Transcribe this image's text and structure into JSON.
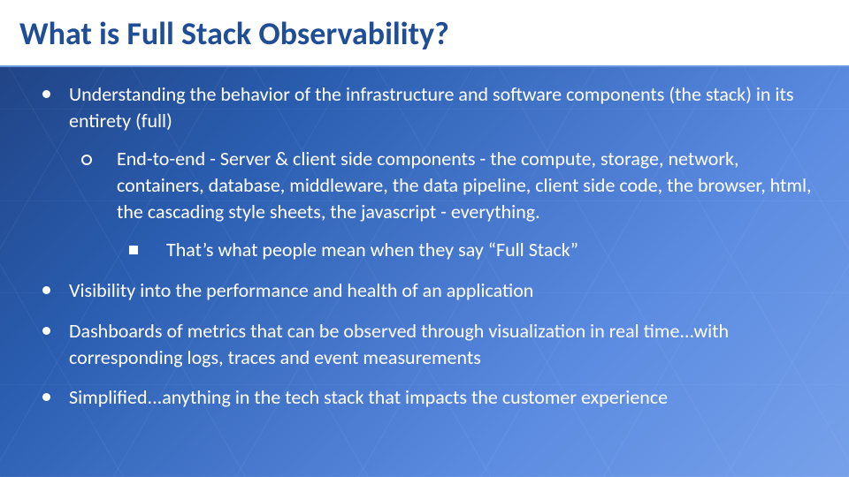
{
  "title": "What is Full Stack Observability?",
  "bullets": {
    "b1": "Understanding the behavior of the infrastructure and software components (the stack) in its entirety (full)",
    "b1_1": "End-to-end - Server & client side components - the compute, storage, network, containers, database, middleware, the data pipeline, client side code, the browser, html, the cascading style sheets, the javascript - everything.",
    "b1_1_1": "That’s what people mean when they say “Full Stack”",
    "b2": "Visibility into the performance and health of an application",
    "b3": "Dashboards of metrics that can be observed through visualization in real time...with corresponding logs, traces and event measurements",
    "b4": "Simplified...anything in the tech stack that impacts the customer experience"
  }
}
